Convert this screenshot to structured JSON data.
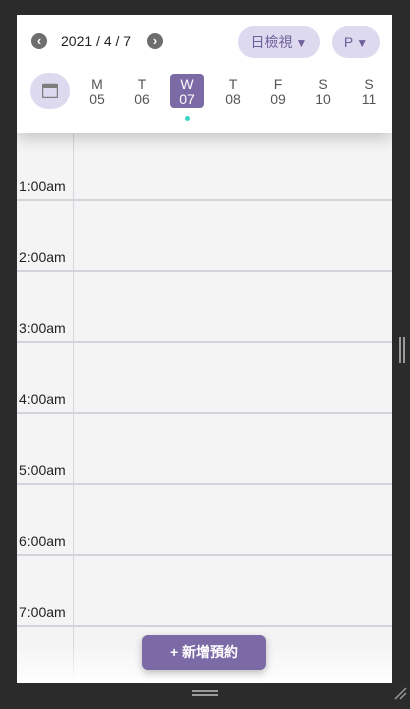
{
  "header": {
    "date": "2021 / 4 / 7",
    "prev_icon": "chevron-left-icon",
    "next_icon": "chevron-right-icon",
    "view_select": {
      "label": "日檢視",
      "caret": "▼"
    },
    "user_select": {
      "label": "P",
      "caret": "▼"
    },
    "calendar_icon": "calendar-icon"
  },
  "week": [
    {
      "letter": "M",
      "num": "05"
    },
    {
      "letter": "T",
      "num": "06"
    },
    {
      "letter": "W",
      "num": "07"
    },
    {
      "letter": "T",
      "num": "08"
    },
    {
      "letter": "F",
      "num": "09"
    },
    {
      "letter": "S",
      "num": "10"
    },
    {
      "letter": "S",
      "num": "11"
    }
  ],
  "selected_day_index": 2,
  "times": [
    "1:00am",
    "2:00am",
    "3:00am",
    "4:00am",
    "5:00am",
    "6:00am",
    "7:00am"
  ],
  "book_button": "+ 新增預約",
  "colors": {
    "accent": "#7b6aa6",
    "pill_bg": "#ddd9ef",
    "dot": "#38d6c3"
  }
}
